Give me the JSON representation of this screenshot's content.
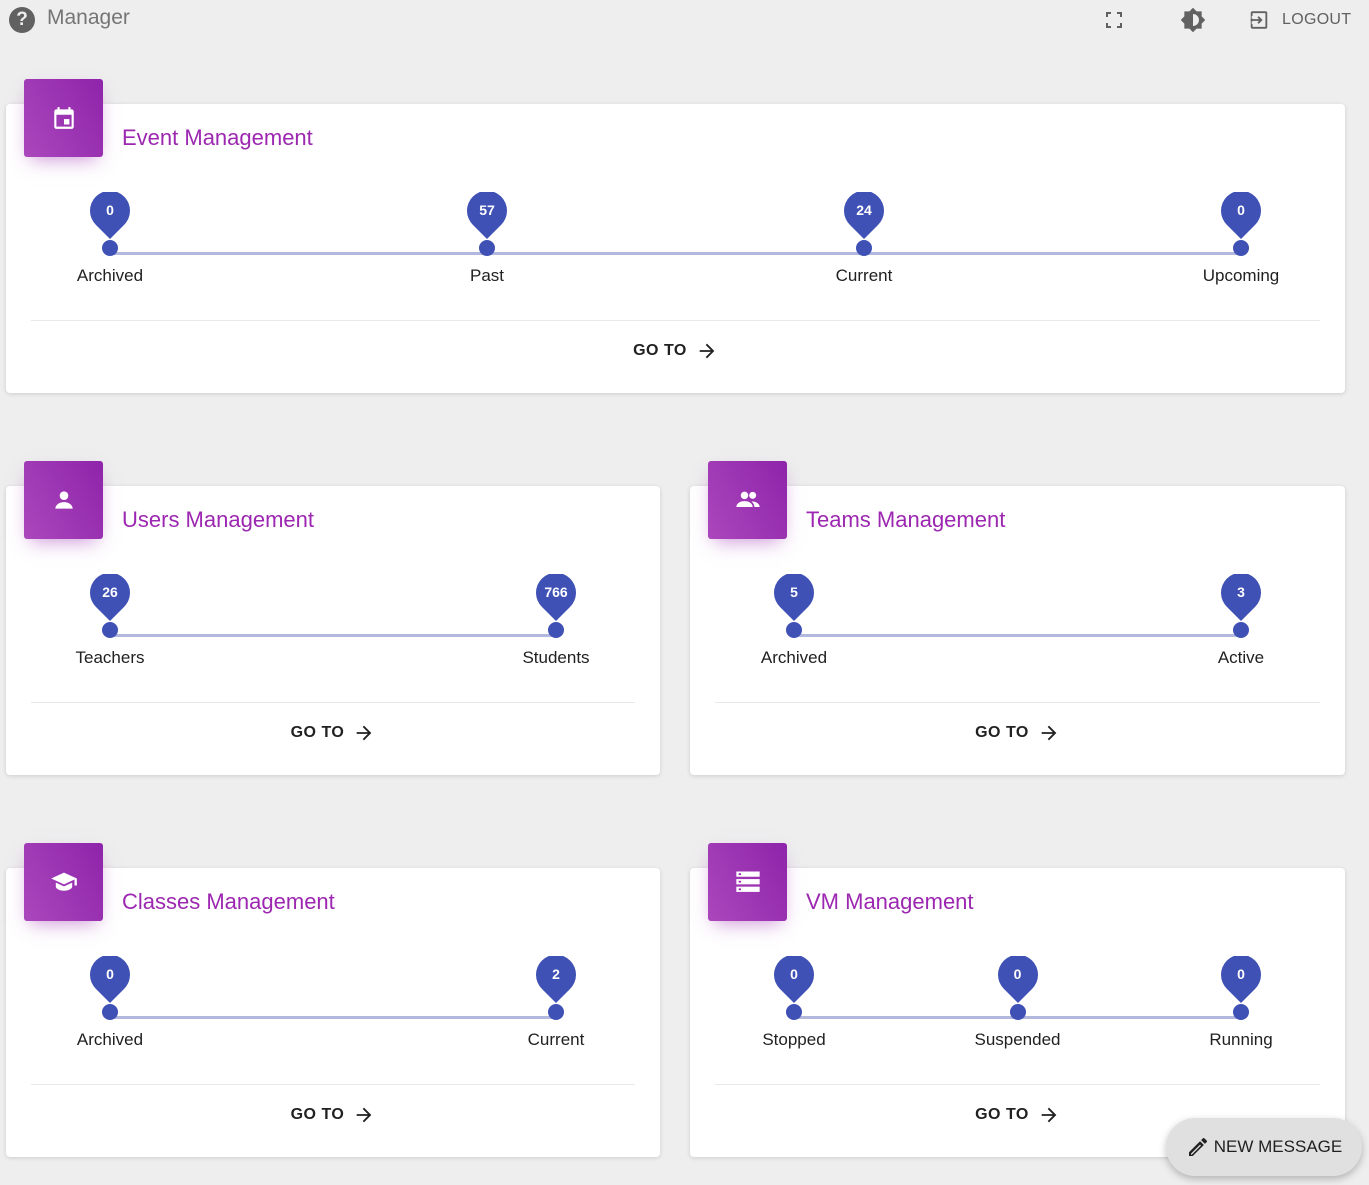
{
  "header": {
    "title": "Manager",
    "help_icon": "help-circle-icon",
    "fullscreen_icon": "fullscreen-icon",
    "theme_icon": "brightness-icon",
    "logout_icon": "logout-icon",
    "logout_label": "LOGOUT"
  },
  "accent_color": "#9c27b0",
  "marker_color": "#3f51b5",
  "cards": [
    {
      "id": "event",
      "title": "Event Management",
      "icon": "calendar-icon",
      "steps": [
        {
          "label": "Archived",
          "value": "0"
        },
        {
          "label": "Past",
          "value": "57"
        },
        {
          "label": "Current",
          "value": "24"
        },
        {
          "label": "Upcoming",
          "value": "0"
        }
      ],
      "goto_label": "GO TO"
    },
    {
      "id": "users",
      "title": "Users Management",
      "icon": "person-icon",
      "steps": [
        {
          "label": "Teachers",
          "value": "26"
        },
        {
          "label": "Students",
          "value": "766"
        }
      ],
      "goto_label": "GO TO"
    },
    {
      "id": "teams",
      "title": "Teams Management",
      "icon": "people-icon",
      "steps": [
        {
          "label": "Archived",
          "value": "5"
        },
        {
          "label": "Active",
          "value": "3"
        }
      ],
      "goto_label": "GO TO"
    },
    {
      "id": "classes",
      "title": "Classes Management",
      "icon": "school-icon",
      "steps": [
        {
          "label": "Archived",
          "value": "0"
        },
        {
          "label": "Current",
          "value": "2"
        }
      ],
      "goto_label": "GO TO"
    },
    {
      "id": "vm",
      "title": "VM Management",
      "icon": "server-icon",
      "steps": [
        {
          "label": "Stopped",
          "value": "0"
        },
        {
          "label": "Suspended",
          "value": "0"
        },
        {
          "label": "Running",
          "value": "0"
        }
      ],
      "goto_label": "GO TO"
    }
  ],
  "fab": {
    "label": "NEW MESSAGE",
    "icon": "pencil-icon"
  }
}
